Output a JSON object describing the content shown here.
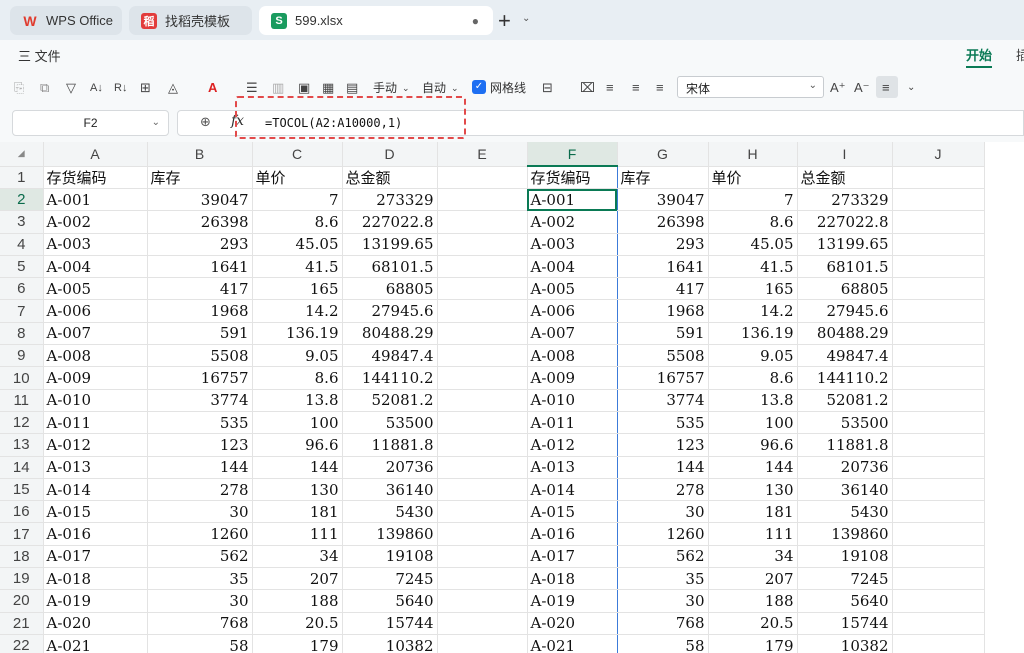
{
  "tabs": [
    {
      "icon": "W",
      "label": "WPS Office",
      "active": false
    },
    {
      "icon": "稻",
      "label": "找稻壳模板",
      "active": false
    },
    {
      "icon": "S",
      "label": "599.xlsx",
      "active": true
    }
  ],
  "menu": {
    "file": "三 文件",
    "home_tab": "开始",
    "next_tab": "插"
  },
  "toolbar": {
    "auto_sum": "手动",
    "auto_fill": "自动",
    "gridlines": "网格线",
    "font": "宋体"
  },
  "formula_bar": {
    "cell": "F2",
    "formula": "=TOCOL(A2:A10000,1)"
  },
  "columns": [
    "A",
    "B",
    "C",
    "D",
    "E",
    "F",
    "G",
    "H",
    "I",
    "J"
  ],
  "selected_column": "F",
  "selected_row": 2,
  "header_row": [
    "存货编码",
    "库存",
    "单价",
    "总金额"
  ],
  "rows": [
    [
      "A-001",
      "39047",
      "7",
      "273329"
    ],
    [
      "A-002",
      "26398",
      "8.6",
      "227022.8"
    ],
    [
      "A-003",
      "293",
      "45.05",
      "13199.65"
    ],
    [
      "A-004",
      "1641",
      "41.5",
      "68101.5"
    ],
    [
      "A-005",
      "417",
      "165",
      "68805"
    ],
    [
      "A-006",
      "1968",
      "14.2",
      "27945.6"
    ],
    [
      "A-007",
      "591",
      "136.19",
      "80488.29"
    ],
    [
      "A-008",
      "5508",
      "9.05",
      "49847.4"
    ],
    [
      "A-009",
      "16757",
      "8.6",
      "144110.2"
    ],
    [
      "A-010",
      "3774",
      "13.8",
      "52081.2"
    ],
    [
      "A-011",
      "535",
      "100",
      "53500"
    ],
    [
      "A-012",
      "123",
      "96.6",
      "11881.8"
    ],
    [
      "A-013",
      "144",
      "144",
      "20736"
    ],
    [
      "A-014",
      "278",
      "130",
      "36140"
    ],
    [
      "A-015",
      "30",
      "181",
      "5430"
    ],
    [
      "A-016",
      "1260",
      "111",
      "139860"
    ],
    [
      "A-017",
      "562",
      "34",
      "19108"
    ],
    [
      "A-018",
      "35",
      "207",
      "7245"
    ],
    [
      "A-019",
      "30",
      "188",
      "5640"
    ],
    [
      "A-020",
      "768",
      "20.5",
      "15744"
    ],
    [
      "A-021",
      "58",
      "179",
      "10382"
    ]
  ],
  "colors": {
    "accent": "#0a7a55",
    "selection_blue": "#3c7bd9",
    "highlight_red": "#e24a4a"
  }
}
